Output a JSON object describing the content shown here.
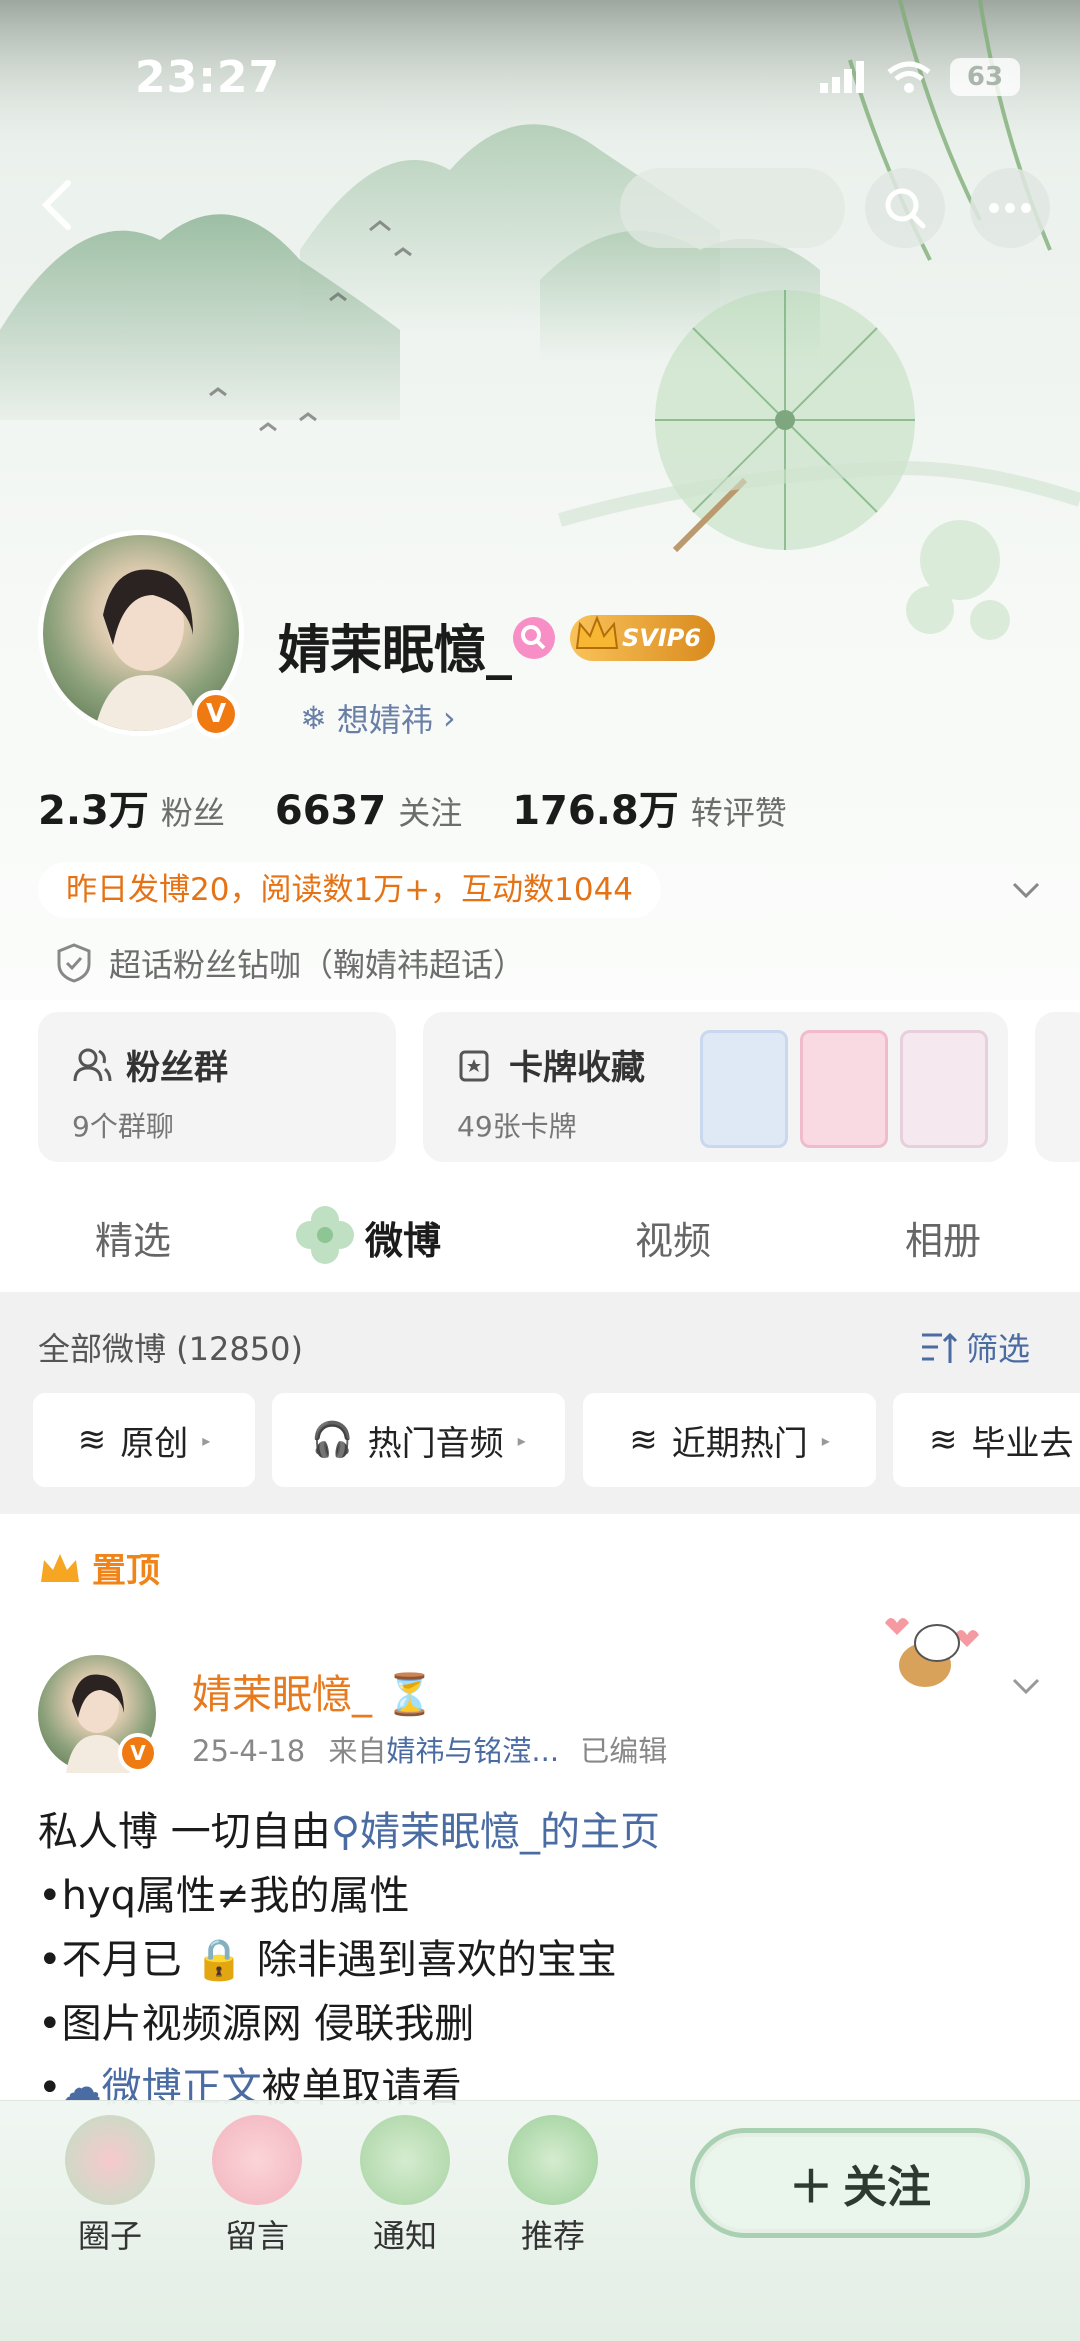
{
  "status_bar": {
    "time": "23:27",
    "battery": "63"
  },
  "profile": {
    "name": "婧茉眠憶_",
    "svip_label": "SVIP6",
    "super_topic": "想婧祎",
    "stats": [
      {
        "num": "2.3万",
        "label": "粉丝"
      },
      {
        "num": "6637",
        "label": "关注"
      },
      {
        "num": "176.8万",
        "label": "转评赞"
      }
    ],
    "activity": "昨日发博20，阅读数1万+，互动数1044",
    "fan_badge": "超话粉丝钻咖（鞠婧祎超话）"
  },
  "cards": {
    "fans_group": {
      "title": "粉丝群",
      "sub": "9个群聊"
    },
    "card_collection": {
      "title": "卡牌收藏",
      "sub": "49张卡牌"
    }
  },
  "tabs": [
    "精选",
    "微博",
    "视频",
    "相册"
  ],
  "feed": {
    "count_label": "全部微博 (12850)",
    "filter_label": "筛选",
    "chips": [
      "原创",
      "热门音频",
      "近期热门",
      "毕业去"
    ]
  },
  "post": {
    "pinned_label": "置顶",
    "author": "婧茉眠憶_",
    "date": "25-4-18",
    "source_prefix": "来自",
    "source": "婧祎与铭滢...",
    "edited": "已编辑",
    "line1_a": "私人博 一切自由",
    "line1_link": "婧茉眠憶_的主页",
    "line2": "•hyq属性≠我的属性",
    "line3_a": "•不月已",
    "line3_b": " 除非遇到喜欢的宝宝",
    "line4": "•图片视频源网  侵联我删",
    "line5_bullet": "•",
    "line5_link": "微博正文",
    "line5_b": "被单取请看"
  },
  "bottom_nav": [
    "圈子",
    "留言",
    "通知",
    "推荐"
  ],
  "follow_label": "关注",
  "colors": {
    "accent_orange": "#e87a1e",
    "link_blue": "#4a6ca3",
    "bg_green": "#e8efe9"
  }
}
